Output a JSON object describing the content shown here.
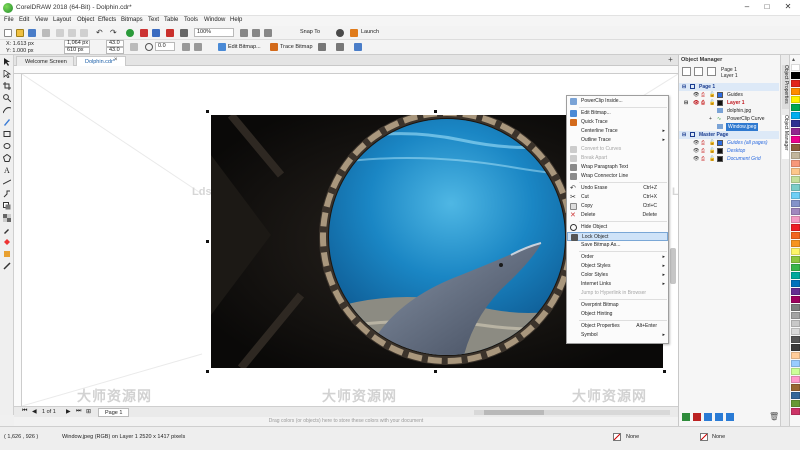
{
  "window": {
    "title": "CorelDRAW 2018 (64-Bit) - Dolphin.cdr*",
    "minimize": "–",
    "maximize": "□",
    "close": "✕"
  },
  "menu": [
    "File",
    "Edit",
    "View",
    "Layout",
    "Object",
    "Effects",
    "Bitmaps",
    "Text",
    "Table",
    "Tools",
    "Window",
    "Help"
  ],
  "toolbar": {
    "zoom": "100%",
    "snap_to": "Snap To",
    "launch": "Launch"
  },
  "propbar": {
    "x": "X: 1.613 px",
    "y": "Y: 1.000 px",
    "w": "1,064 px",
    "h": "610 px",
    "scale_x": "43.0",
    "scale_y": "43.0",
    "rotation": "0.0",
    "edit_bitmap": "Edit Bitmap...",
    "trace_bitmap": "Trace Bitmap"
  },
  "tabs": [
    {
      "label": "Welcome Screen"
    },
    {
      "label": "Dolphin.cdr*"
    }
  ],
  "watermarks": {
    "site": "Ldspsd.com",
    "cn": "大师资源网",
    "cn_url": "www.Ldspsd.com"
  },
  "context_menu": [
    {
      "label": "PowerClip Inside...",
      "shortcut": "",
      "submenu": false,
      "disabled": false,
      "icon": "powerclip-icon"
    },
    {
      "sep": true
    },
    {
      "label": "Edit Bitmap...",
      "shortcut": "",
      "submenu": false,
      "disabled": false,
      "icon": "edit-bitmap-icon"
    },
    {
      "label": "Quick Trace",
      "shortcut": "",
      "submenu": false,
      "disabled": false,
      "icon": "quick-trace-icon"
    },
    {
      "label": "Centerline Trace",
      "shortcut": "",
      "submenu": true,
      "disabled": false,
      "icon": ""
    },
    {
      "label": "Outline Trace",
      "shortcut": "",
      "submenu": true,
      "disabled": false,
      "icon": ""
    },
    {
      "label": "Convert to Curves",
      "shortcut": "",
      "submenu": false,
      "disabled": true,
      "icon": "convert-curves-icon"
    },
    {
      "label": "Break Apart",
      "shortcut": "",
      "submenu": false,
      "disabled": true,
      "icon": "break-apart-icon"
    },
    {
      "label": "Wrap Paragraph Text",
      "shortcut": "",
      "submenu": false,
      "disabled": false,
      "icon": "wrap-text-icon"
    },
    {
      "label": "Wrap Connector Line",
      "shortcut": "",
      "submenu": false,
      "disabled": false,
      "icon": "wrap-connector-icon"
    },
    {
      "sep": true
    },
    {
      "label": "Undo Erase",
      "shortcut": "Ctrl+Z",
      "submenu": false,
      "disabled": false,
      "icon": "undo-icon"
    },
    {
      "label": "Cut",
      "shortcut": "Ctrl+X",
      "submenu": false,
      "disabled": false,
      "icon": "cut-icon"
    },
    {
      "label": "Copy",
      "shortcut": "Ctrl+C",
      "submenu": false,
      "disabled": false,
      "icon": "copy-icon"
    },
    {
      "label": "Delete",
      "shortcut": "Delete",
      "submenu": false,
      "disabled": false,
      "icon": "delete-icon"
    },
    {
      "sep": true
    },
    {
      "label": "Hide Object",
      "shortcut": "",
      "submenu": false,
      "disabled": false,
      "icon": "eye-icon"
    },
    {
      "label": "Lock Object",
      "shortcut": "",
      "submenu": false,
      "disabled": false,
      "icon": "lock-icon",
      "highlight": true
    },
    {
      "label": "Save Bitmap As...",
      "shortcut": "",
      "submenu": false,
      "disabled": false,
      "icon": ""
    },
    {
      "sep": true
    },
    {
      "label": "Order",
      "shortcut": "",
      "submenu": true,
      "disabled": false,
      "icon": ""
    },
    {
      "label": "Object Styles",
      "shortcut": "",
      "submenu": true,
      "disabled": false,
      "icon": ""
    },
    {
      "label": "Color Styles",
      "shortcut": "",
      "submenu": true,
      "disabled": false,
      "icon": ""
    },
    {
      "label": "Internet Links",
      "shortcut": "",
      "submenu": true,
      "disabled": false,
      "icon": ""
    },
    {
      "label": "Jump to Hyperlink in Browser",
      "shortcut": "",
      "submenu": false,
      "disabled": true,
      "icon": ""
    },
    {
      "sep": true
    },
    {
      "label": "Overprint Bitmap",
      "shortcut": "",
      "submenu": false,
      "disabled": false,
      "icon": ""
    },
    {
      "label": "Object Hinting",
      "shortcut": "",
      "submenu": false,
      "disabled": false,
      "icon": ""
    },
    {
      "sep": true
    },
    {
      "label": "Object Properties",
      "shortcut": "Alt+Enter",
      "submenu": false,
      "disabled": false,
      "icon": ""
    },
    {
      "label": "Symbol",
      "shortcut": "",
      "submenu": true,
      "disabled": false,
      "icon": ""
    }
  ],
  "object_manager": {
    "title": "Object Manager",
    "page_label": "Page 1",
    "layer_label": "Layer 1",
    "tree": [
      {
        "label": "Page 1",
        "indent": 0,
        "bold": true,
        "color": "#1a3c8f",
        "bg": "#dde9f7"
      },
      {
        "label": "Guides",
        "indent": 1,
        "color": "#222",
        "swatch": "#2b6be0"
      },
      {
        "label": "Layer 1",
        "indent": 1,
        "color": "#c0161c",
        "swatch": "#111",
        "bold": true
      },
      {
        "label": "dolphin.jpg",
        "indent": 2,
        "color": "#222"
      },
      {
        "label": "PowerClip Curve",
        "indent": 2,
        "color": "#222"
      },
      {
        "label": "Window.jpeg",
        "indent": 2,
        "color": "#fff",
        "bg": "#2f79d0"
      },
      {
        "label": "Master Page",
        "indent": 0,
        "bold": true,
        "color": "#1a3c8f",
        "bg": "#dde9f7"
      },
      {
        "label": "Guides (all pages)",
        "indent": 1,
        "color": "#2b6be0",
        "swatch": "#2b6be0",
        "italic": true
      },
      {
        "label": "Desktop",
        "indent": 1,
        "color": "#2b6be0",
        "swatch": "#111",
        "italic": true
      },
      {
        "label": "Document Grid",
        "indent": 1,
        "color": "#2b6be0",
        "swatch": "#111",
        "italic": true
      }
    ]
  },
  "side_tabs": [
    "Object Properties",
    "Object Manager"
  ],
  "palette": [
    "#ffffff",
    "#000000",
    "#e2231a",
    "#ff8c00",
    "#fff200",
    "#00a651",
    "#00aeef",
    "#2e3192",
    "#92278f",
    "#ec008c",
    "#8b5e3c",
    "#c2b59b",
    "#f7977a",
    "#fdc68a",
    "#c4df9b",
    "#7bcdc8",
    "#6ecff6",
    "#8493ca",
    "#a187be",
    "#f49ac2",
    "#ed1c24",
    "#f26522",
    "#f7941d",
    "#fff568",
    "#8dc63f",
    "#39b54a",
    "#00a99d",
    "#0072bc",
    "#662d91",
    "#9e005d",
    "#7d7d7d",
    "#a3a3a3",
    "#c8c8c8",
    "#dadada",
    "#555555",
    "#3a3a3a",
    "#ffcc99",
    "#99ccff",
    "#ccff99",
    "#ff99cc",
    "#996633",
    "#336699",
    "#669933",
    "#cc3366"
  ],
  "navigator": {
    "page_of": "1 of 1",
    "page_tab": "Page 1"
  },
  "hint": "Drag colors (or objects) here to store these colors with your document",
  "status": {
    "coords": "( 1,626 , 926 )",
    "info": "Window.jpeg (RGB) on Layer 1 2520 x 1417 pixels",
    "fill": "None",
    "outline": "None"
  }
}
